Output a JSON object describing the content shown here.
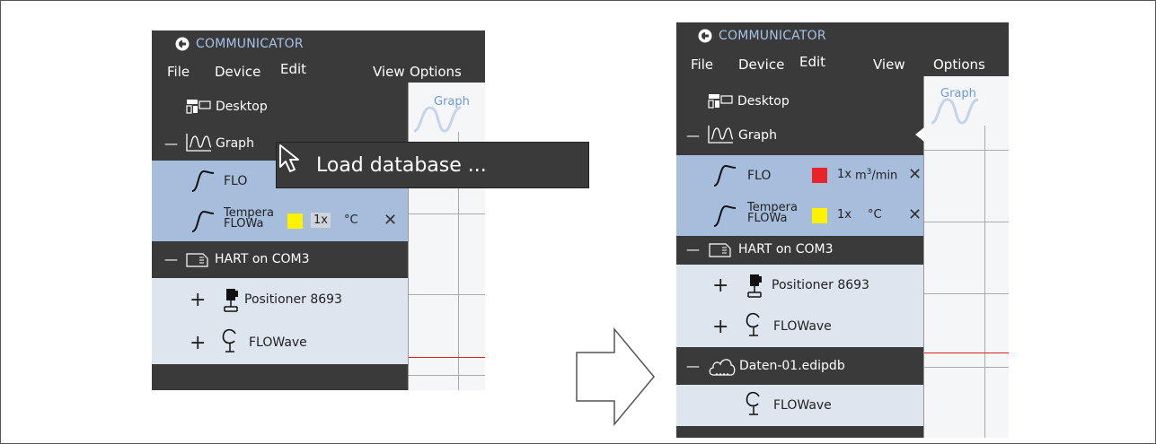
{
  "app": {
    "title": "COMMUNICATOR"
  },
  "menu": [
    "File",
    "Device",
    "Edit",
    "View",
    "Options"
  ],
  "graph_pane": {
    "label": "Graph"
  },
  "tooltip": {
    "text": "Load database ..."
  },
  "before": {
    "desktop": "Desktop",
    "graph": "Graph",
    "channel1": {
      "name": "FLO"
    },
    "channel2": {
      "name_line1": "Tempera",
      "name_line2": "FLOWa",
      "scale": "1x",
      "unit": "°C",
      "color": "#fff200"
    },
    "hart": "HART on COM3",
    "device1": "Positioner 8693",
    "device2": "FLOWave",
    "collapse_symbol": "—",
    "expand_symbol": "+",
    "close_symbol": "✕"
  },
  "after": {
    "desktop": "Desktop",
    "graph": "Graph",
    "channel1": {
      "name": "FLO",
      "scale": "1x",
      "unit_base": "m",
      "unit_exp": "3",
      "unit_tail": "/min",
      "color": "#e8232a"
    },
    "channel2": {
      "name_line1": "Tempera",
      "name_line2": "FLOWa",
      "scale": "1x",
      "unit": "°C",
      "color": "#fff200"
    },
    "hart": "HART on COM3",
    "device1": "Positioner 8693",
    "device2": "FLOWave",
    "database": "Daten-01.edipdb",
    "db_device": "FLOWave",
    "collapse_symbol": "—",
    "expand_symbol": "+",
    "close_symbol": "✕"
  }
}
